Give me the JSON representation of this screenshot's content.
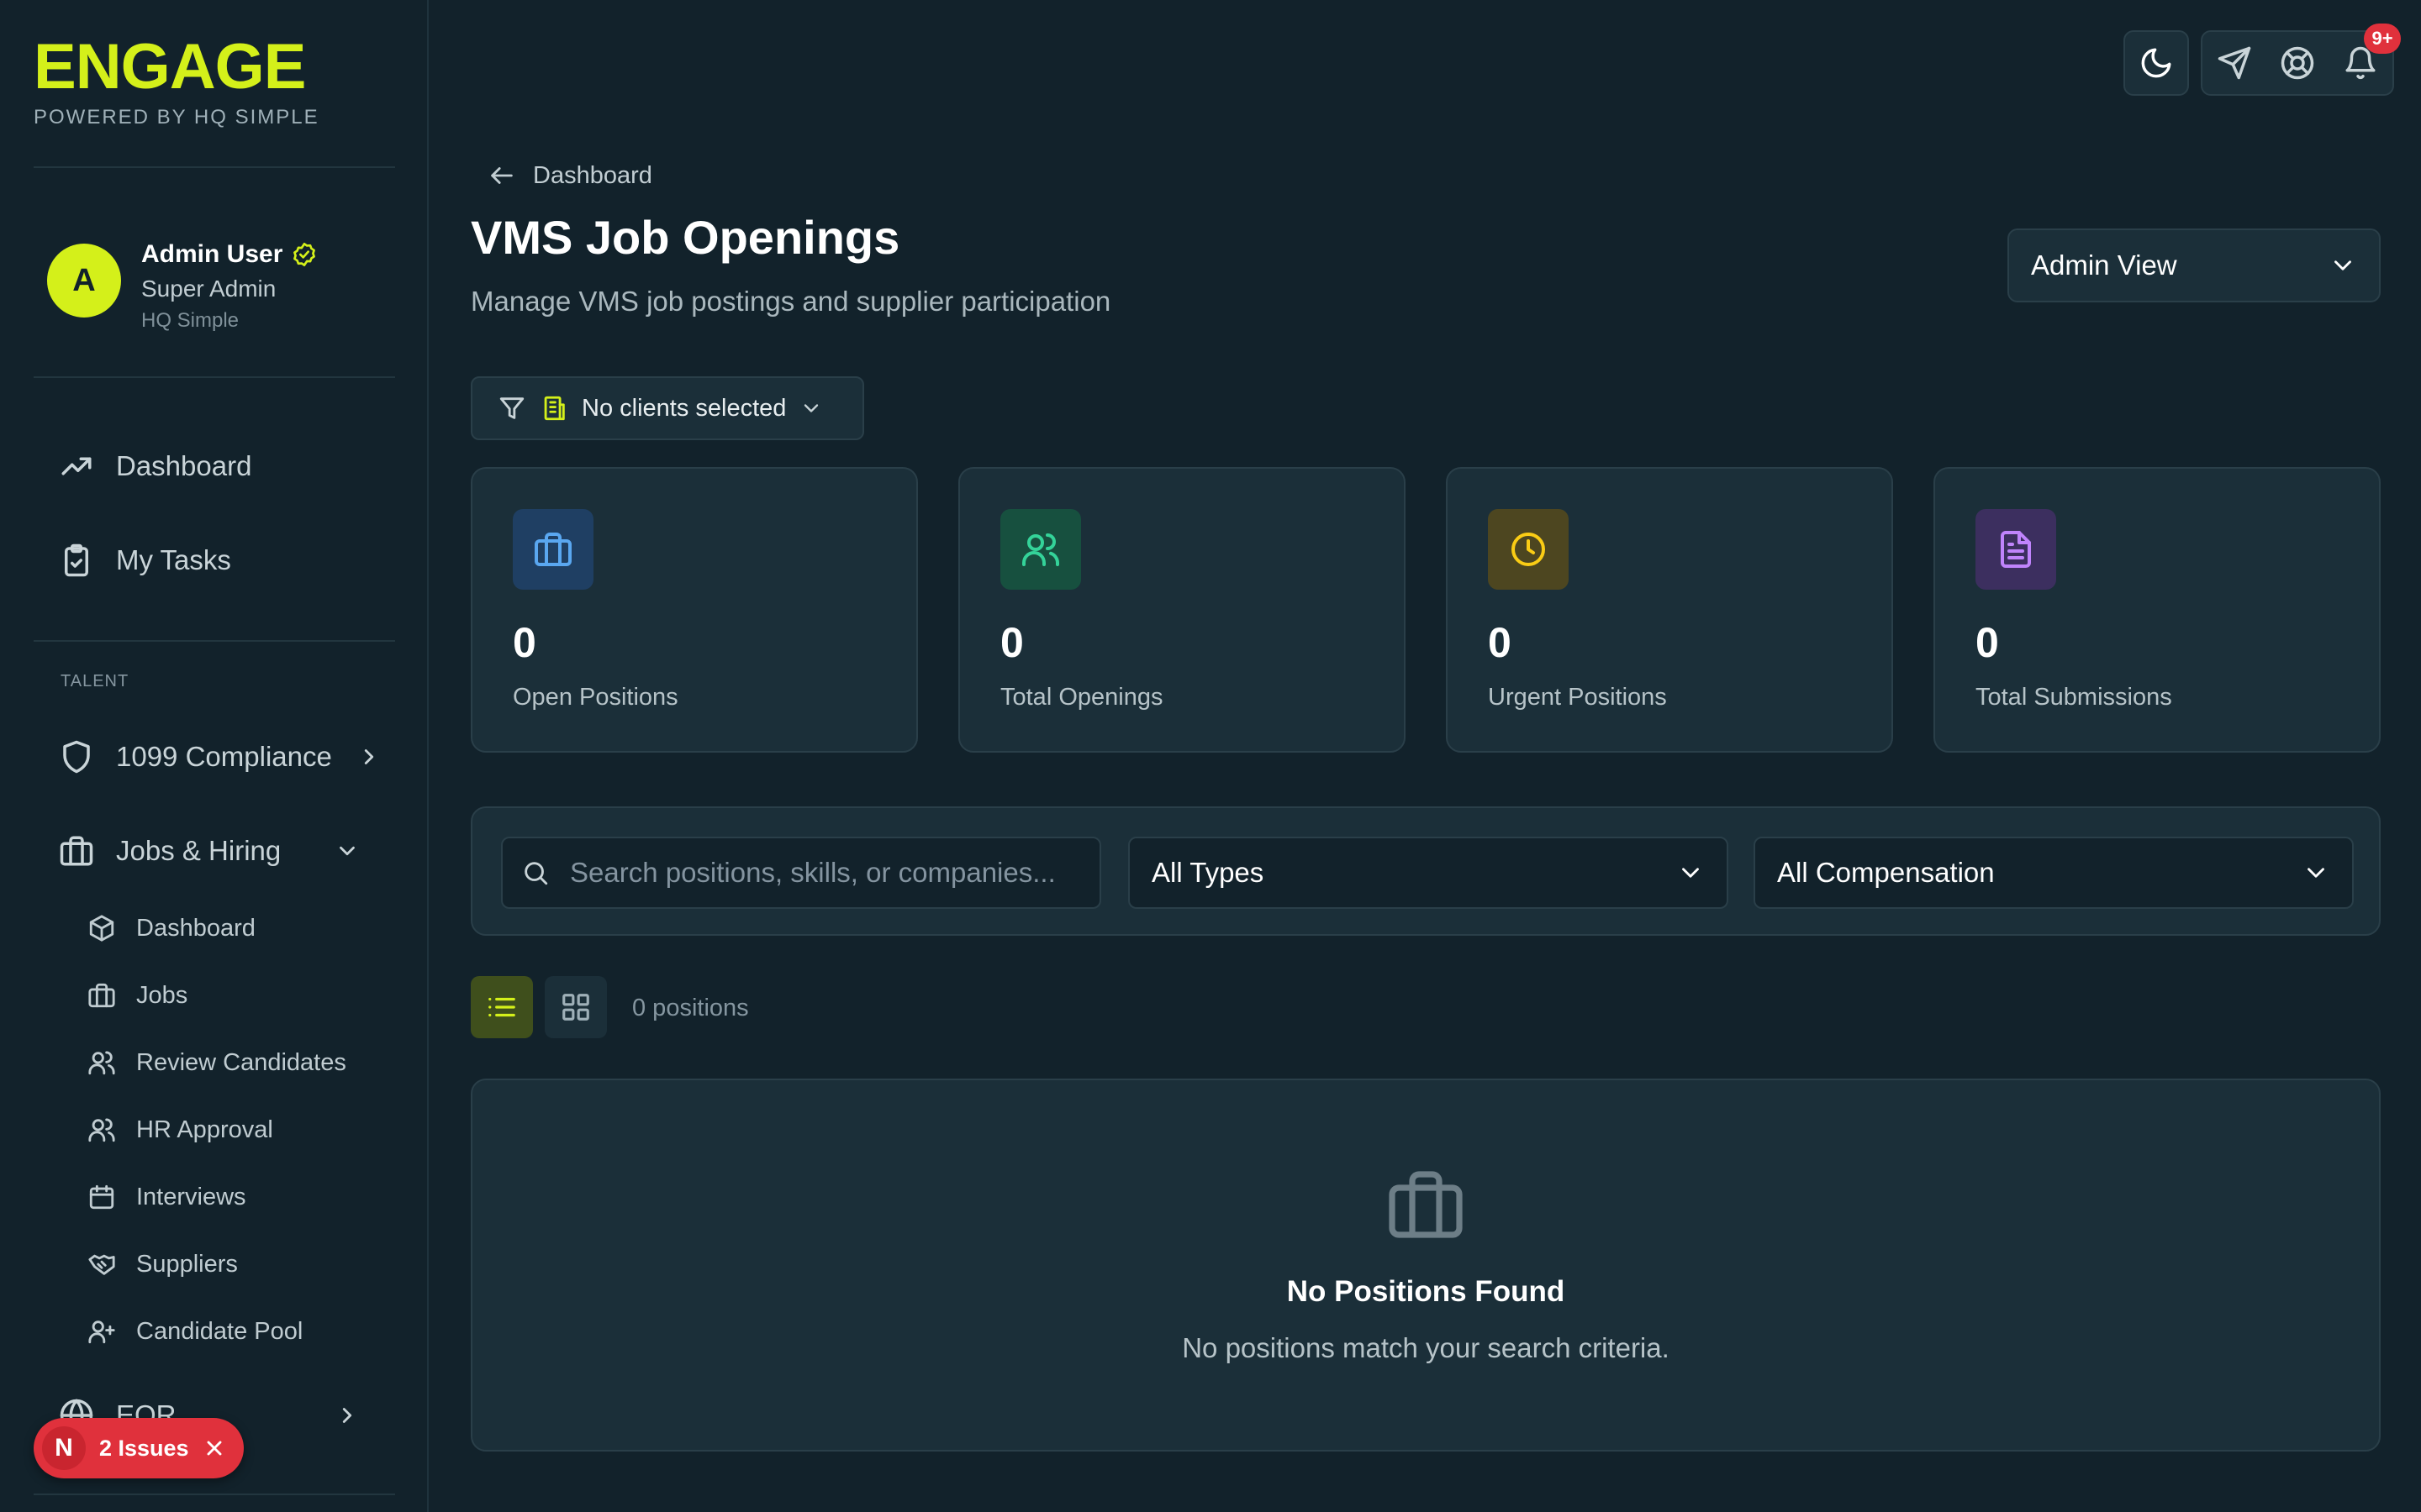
{
  "brand": {
    "title": "ENGAGE",
    "subtitle": "POWERED BY HQ SIMPLE"
  },
  "user": {
    "initial": "A",
    "name": "Admin User",
    "role": "Super Admin",
    "org": "HQ Simple"
  },
  "nav": {
    "dashboard": "Dashboard",
    "tasks": "My Tasks",
    "section_talent": "TALENT",
    "compliance": "1099 Compliance",
    "jobs_hiring": "Jobs & Hiring",
    "sub": {
      "dashboard": "Dashboard",
      "jobs": "Jobs",
      "review": "Review Candidates",
      "hr_approval": "HR Approval",
      "interviews": "Interviews",
      "suppliers": "Suppliers",
      "pool": "Candidate Pool"
    },
    "eor": "EOR"
  },
  "issues": {
    "initial": "N",
    "label": "2 Issues"
  },
  "notifications": {
    "badge": "9+"
  },
  "header": {
    "back_label": "Dashboard",
    "title": "VMS Job Openings",
    "subtitle": "Manage VMS job postings and supplier participation",
    "view_select": "Admin View"
  },
  "client_filter": {
    "label": "No clients selected"
  },
  "stats": [
    {
      "value": "0",
      "label": "Open Positions"
    },
    {
      "value": "0",
      "label": "Total Openings"
    },
    {
      "value": "0",
      "label": "Urgent Positions"
    },
    {
      "value": "0",
      "label": "Total Submissions"
    }
  ],
  "filters": {
    "search_placeholder": "Search positions, skills, or companies...",
    "types": "All Types",
    "compensation": "All Compensation"
  },
  "list": {
    "count": "0 positions"
  },
  "empty": {
    "title": "No Positions Found",
    "subtitle": "No positions match your search criteria."
  },
  "colors": {
    "accent": "#d4f01a",
    "background": "#12222b",
    "card": "#1b2f39",
    "danger": "#e0313c"
  }
}
